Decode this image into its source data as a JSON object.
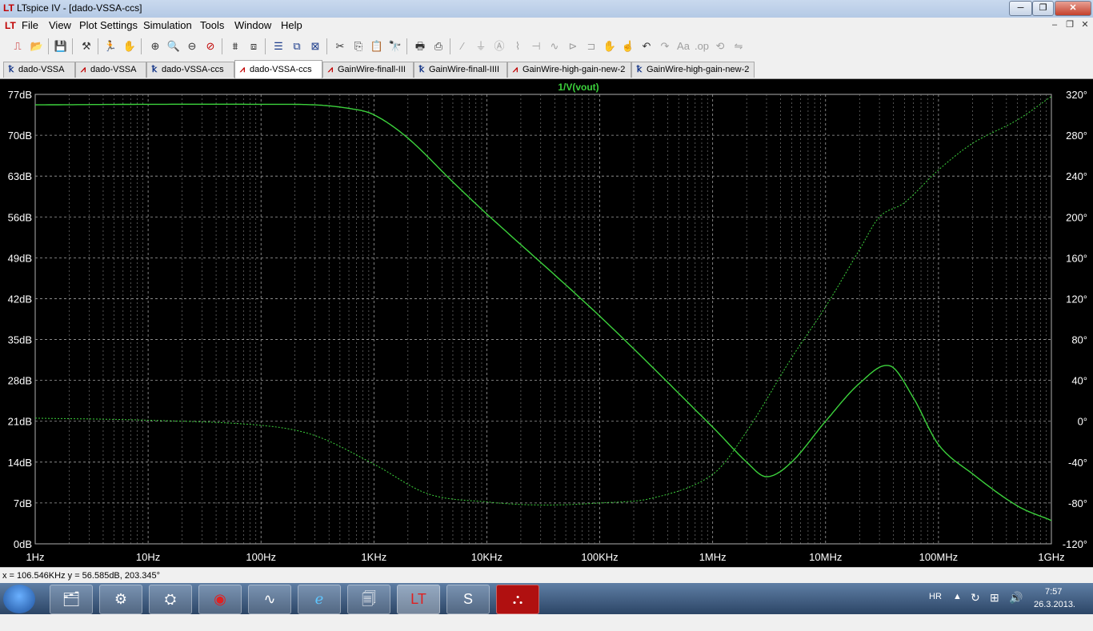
{
  "window": {
    "title": "LTspice IV - [dado-VSSA-ccs]",
    "app_icon": "ltspice-icon",
    "min_label": "─",
    "max_label": "❐",
    "close_label": "✕"
  },
  "menu": {
    "items": [
      "File",
      "View",
      "Plot Settings",
      "Simulation",
      "Tools",
      "Window",
      "Help"
    ],
    "mdi_min": "–",
    "mdi_restore": "❐",
    "mdi_close": "✕"
  },
  "toolbar": {
    "icons": [
      "new-schematic-icon",
      "open-icon",
      "save-icon",
      "control-panel-icon",
      "run-icon",
      "halt-icon",
      "zoom-in-icon",
      "zoom-pan-icon",
      "zoom-out-icon",
      "zoom-cancel-icon",
      "autorange-icon",
      "zoom-extents-icon",
      "tile-horizontal-icon",
      "cascade-icon",
      "close-all-icon",
      "cut-icon",
      "copy-icon",
      "paste-icon",
      "find-icon",
      "print-preview-icon",
      "print-icon",
      "wire-icon",
      "ground-icon",
      "label-icon",
      "resistor-icon",
      "capacitor-icon",
      "inductor-icon",
      "diode-icon",
      "component-icon",
      "move-icon",
      "drag-icon",
      "undo-icon",
      "redo-icon",
      "text-icon",
      "spice-directive-icon",
      "rotate-icon",
      "mirror-icon"
    ]
  },
  "tabs": [
    {
      "label": "dado-VSSA",
      "type": "schematic",
      "active": false
    },
    {
      "label": "dado-VSSA",
      "type": "waveform",
      "active": false
    },
    {
      "label": "dado-VSSA-ccs",
      "type": "schematic",
      "active": false
    },
    {
      "label": "dado-VSSA-ccs",
      "type": "waveform",
      "active": true
    },
    {
      "label": "GainWire-finall-III",
      "type": "waveform",
      "active": false
    },
    {
      "label": "GainWire-finall-IIII",
      "type": "schematic",
      "active": false
    },
    {
      "label": "GainWire-high-gain-new-2",
      "type": "waveform",
      "active": false
    },
    {
      "label": "GainWire-high-gain-new-2",
      "type": "schematic",
      "active": false
    }
  ],
  "chart_data": {
    "type": "line",
    "title": "1/V(vout)",
    "x_scale": "log",
    "xlim": [
      1,
      1000000000
    ],
    "x_ticks": [
      "1Hz",
      "10Hz",
      "100Hz",
      "1KHz",
      "10KHz",
      "100KHz",
      "1MHz",
      "10MHz",
      "100MHz",
      "1GHz"
    ],
    "y_left_ticks": [
      "77dB",
      "70dB",
      "63dB",
      "56dB",
      "49dB",
      "42dB",
      "35dB",
      "28dB",
      "21dB",
      "14dB",
      "7dB",
      "0dB"
    ],
    "y_right_ticks": [
      "320°",
      "280°",
      "240°",
      "200°",
      "160°",
      "120°",
      "80°",
      "40°",
      "0°",
      "-40°",
      "-80°",
      "-120°"
    ],
    "ylim_left": [
      0,
      77
    ],
    "ylim_right": [
      -120,
      320
    ],
    "grid": true,
    "trace_color": "#3cd23c",
    "background": "#000000",
    "series": [
      {
        "name": "1/V(vout)",
        "quantity": "magnitude_dB",
        "style": "solid",
        "x": [
          1,
          10,
          100,
          300,
          600,
          1000,
          2000,
          5000,
          10000,
          100000,
          1000000,
          2000000,
          3000000,
          5000000,
          10000000,
          20000000,
          37000000,
          60000000,
          100000000,
          200000000,
          500000000,
          1000000000
        ],
        "y": [
          75.2,
          75.3,
          75.3,
          75.2,
          74.6,
          73.5,
          69.5,
          62.0,
          56.5,
          39.0,
          20.0,
          14.0,
          11.5,
          14.0,
          21.0,
          27.5,
          30.5,
          25.0,
          17.0,
          12.0,
          6.5,
          4.0
        ]
      },
      {
        "name": "phase",
        "quantity": "phase_deg",
        "style": "dotted",
        "x": [
          1,
          10,
          100,
          300,
          1000,
          3000,
          10000,
          30000,
          100000,
          300000,
          1000000,
          2000000,
          5000000,
          10000000,
          20000000,
          30000000,
          50000000,
          100000000,
          200000000,
          500000000,
          1000000000
        ],
        "y": [
          3,
          1,
          -4,
          -14,
          -42,
          -71,
          -79,
          -82,
          -80,
          -75,
          -52,
          -10,
          62,
          112,
          168,
          200,
          214,
          246,
          272,
          295,
          318
        ]
      }
    ]
  },
  "status_bar": {
    "cursor_readout": "x = 106.546KHz   y = 56.585dB, 203.345°"
  },
  "taskbar": {
    "apps": [
      "explorer-icon",
      "installer-icon",
      "app-icon",
      "antivirus-icon",
      "oscilloscope-icon",
      "ie-icon",
      "notes-icon",
      "ltspice-icon",
      "skype-icon",
      "pdf-icon"
    ],
    "language": "HR",
    "time": "7:57",
    "date": "26.3.2013."
  }
}
